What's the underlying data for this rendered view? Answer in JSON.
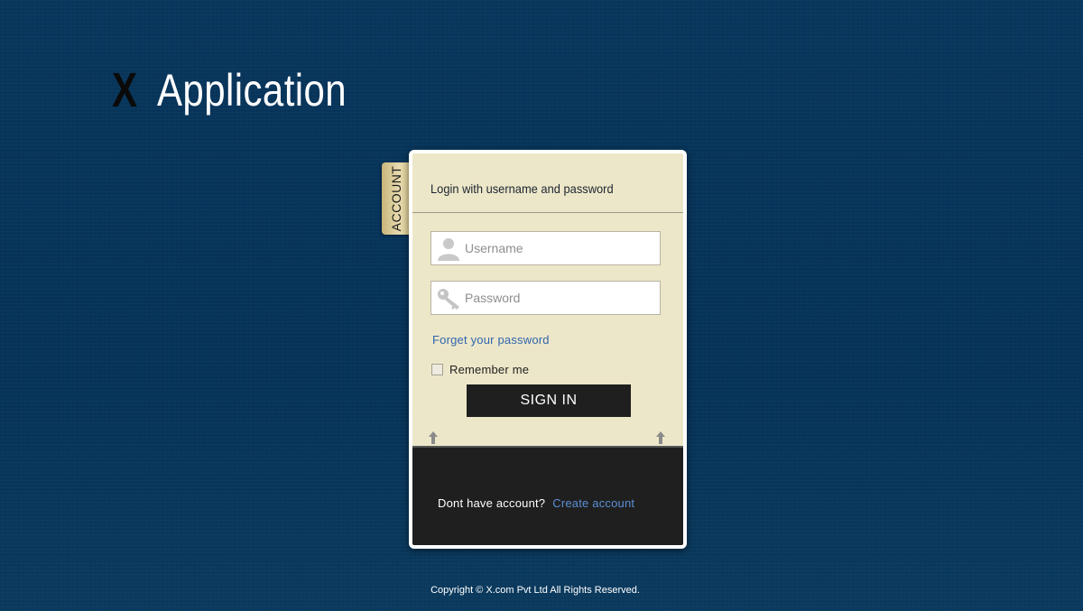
{
  "app": {
    "logo_mark": "X",
    "title": "Application"
  },
  "side_tab": {
    "label": "ACCOUNT"
  },
  "login": {
    "title": "Login with username and password",
    "username": {
      "placeholder": "Username",
      "value": "",
      "icon": "user-icon"
    },
    "password": {
      "placeholder": "Password",
      "value": "",
      "icon": "key-icon"
    },
    "forgot_link": "Forget your password",
    "remember_label": "Remember me",
    "remember_checked": false,
    "signin_label": "SIGN IN"
  },
  "signup": {
    "prompt": "Dont have account?",
    "link": "Create account"
  },
  "footer": {
    "copyright": "Copyright © X.com Pvt Ltd All Rights Reserved."
  },
  "colors": {
    "background": "#073459",
    "card": "#ede7c9",
    "button": "#1f1f1f",
    "link": "#2f65ad",
    "tab": "#d6c58e"
  }
}
